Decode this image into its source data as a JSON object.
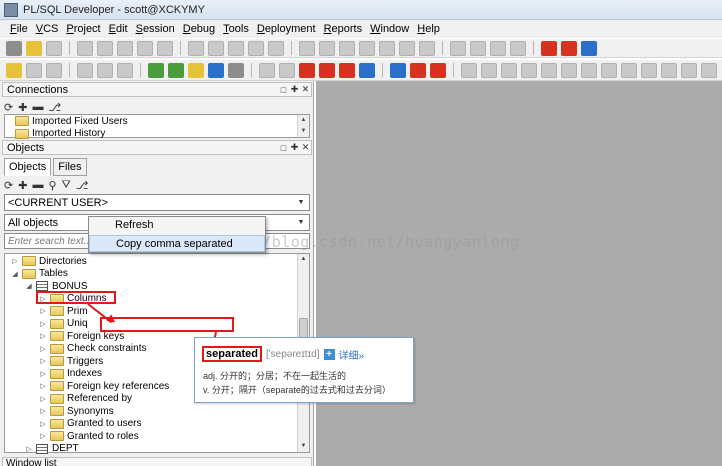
{
  "window": {
    "title": "PL/SQL Developer - scott@XCKYMY"
  },
  "menu": [
    "File",
    "VCS",
    "Project",
    "Edit",
    "Session",
    "Debug",
    "Tools",
    "Deployment",
    "Reports",
    "Window",
    "Help"
  ],
  "connections": {
    "title": "Connections",
    "items": [
      "Imported Fixed Users",
      "Imported History"
    ]
  },
  "objects": {
    "title": "Objects",
    "tabs": [
      "Objects",
      "Files"
    ],
    "user_filter": "<CURRENT USER>",
    "object_filter": "All objects",
    "search_placeholder": "Enter search text...",
    "tree": {
      "directories": "Directories",
      "tables": "Tables",
      "bonus": "BONUS",
      "columns": "Columns",
      "primary": "Prim",
      "unique": "Uniq",
      "foreign_keys": "Foreign keys",
      "check_constraints": "Check constraints",
      "triggers": "Triggers",
      "indexes": "Indexes",
      "foreign_key_refs": "Foreign key references",
      "referenced_by": "Referenced by",
      "synonyms": "Synonyms",
      "granted_to_users": "Granted to users",
      "granted_to_roles": "Granted to roles",
      "dept": "DEPT"
    }
  },
  "context_menu": {
    "refresh": "Refresh",
    "copy_comma": "Copy comma separated"
  },
  "tooltip": {
    "word": "separated",
    "phonetic": "['sepəreɪtɪd]",
    "more": "详细»",
    "def_adj": "adj. 分开的；分居；不在一起生活的",
    "def_v": "v. 分开；隔开（separate的过去式和过去分词）"
  },
  "watermark": "http://blog.csdn.net/huangyanlong",
  "window_list": {
    "title": "Window list"
  }
}
